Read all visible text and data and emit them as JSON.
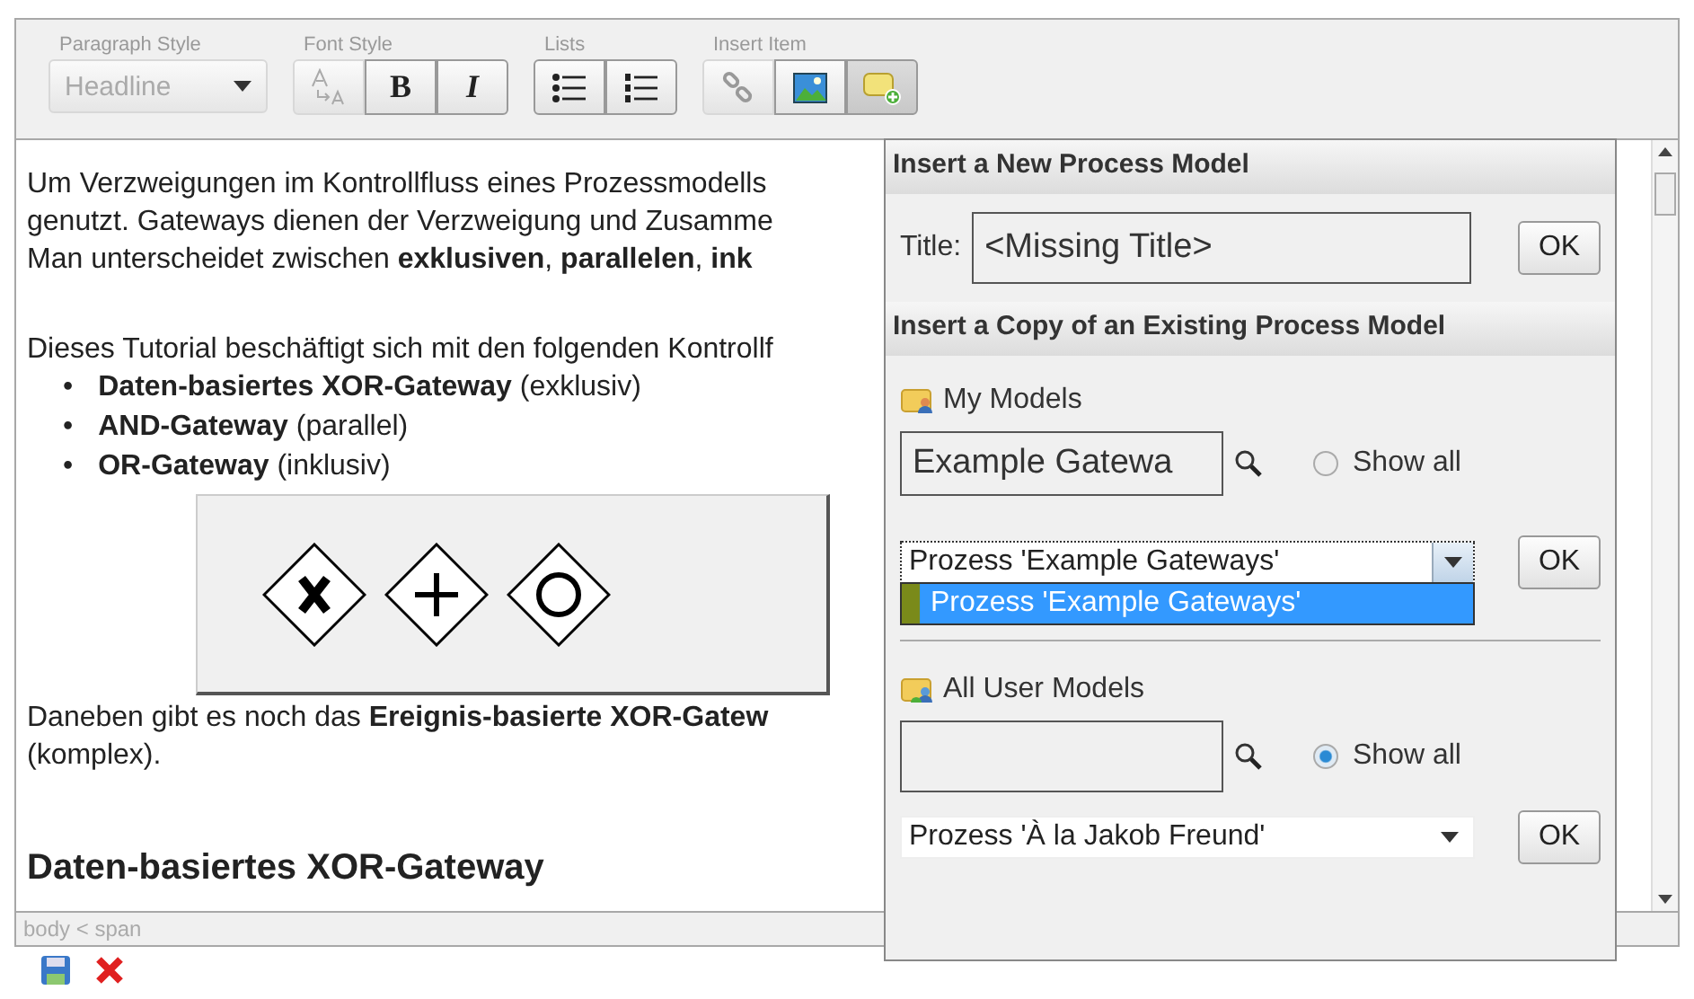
{
  "toolbar": {
    "groups": [
      {
        "label": "Paragraph Style",
        "kind": "select",
        "value": "Headline",
        "disabled": true
      },
      {
        "label": "Font Style",
        "kind": "buttons",
        "buttons": [
          {
            "kind": "font-size",
            "disabled": true,
            "active": false
          },
          {
            "kind": "bold",
            "text": "B",
            "disabled": false,
            "active": false
          },
          {
            "kind": "italic",
            "text": "I",
            "disabled": false,
            "active": false
          }
        ]
      },
      {
        "label": "Lists",
        "kind": "buttons",
        "buttons": [
          {
            "kind": "bullet-list",
            "disabled": false,
            "active": false
          },
          {
            "kind": "numbered-list",
            "disabled": false,
            "active": false
          }
        ]
      },
      {
        "label": "Insert Item",
        "kind": "buttons",
        "buttons": [
          {
            "kind": "link",
            "disabled": true,
            "active": false
          },
          {
            "kind": "image",
            "disabled": false,
            "active": false
          },
          {
            "kind": "new-model",
            "disabled": false,
            "active": true
          }
        ]
      }
    ]
  },
  "content": {
    "blocks": [
      {
        "kind": "lines",
        "lines": [
          "Um Verzweigungen im Kontrollfluss eines Prozessmodells",
          "genutzt. Gateways dienen der Verzweigung und Zusamme",
          "Man unterscheidet zwischen **exklusiven**, **parallelen**, **ink**"
        ]
      },
      {
        "kind": "lines",
        "lines": [
          "Dieses Tutorial beschäftigt sich mit den folgenden Kontrollf"
        ]
      },
      {
        "kind": "bullets",
        "items": [
          {
            "marker": "•",
            "text": "**Daten-basiertes XOR-Gateway** (exklusiv)"
          },
          {
            "marker": "•",
            "text": "**AND-Gateway** (parallel)"
          },
          {
            "marker": "•",
            "text": "**OR-Gateway** (inklusiv)"
          }
        ]
      },
      {
        "kind": "lines",
        "lines": [
          "Daneben gibt es noch das **Ereignis-basierte XOR-Gatew**",
          "(komplex)."
        ]
      },
      {
        "kind": "heading",
        "text": "Daten-basiertes XOR-Gateway"
      }
    ],
    "figure": {
      "gateways": [
        {
          "kind": "xor"
        },
        {
          "kind": "and"
        },
        {
          "kind": "or"
        }
      ]
    }
  },
  "status_bar": {
    "path": "body < span"
  },
  "popup": {
    "new_section": {
      "heading": "Insert a New Process Model",
      "title_label": "Title:",
      "title_value": "<Missing Title>",
      "ok": "OK"
    },
    "copy_section": {
      "heading": "Insert a Copy of an Existing Process Model",
      "groups": [
        {
          "kind": "mine",
          "label": "My Models",
          "search_value": "Example Gatewa",
          "show_all": {
            "label": "Show all",
            "selected": false
          },
          "select_value": "Prozess 'Example Gateways'",
          "dropdown_open": true,
          "options": [
            {
              "label": "Prozess 'Example Gateways'",
              "selected": true
            }
          ],
          "ok": "OK"
        },
        {
          "kind": "all",
          "label": "All User Models",
          "show_all": {
            "label": "Show all",
            "selected": true
          },
          "select_value": "Prozess 'À la Jakob Freund'",
          "dropdown_open": false,
          "ok": "OK"
        }
      ]
    }
  }
}
